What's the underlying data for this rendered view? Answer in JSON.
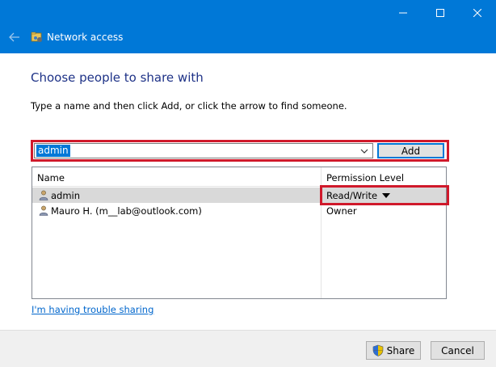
{
  "window": {
    "title": "Network access",
    "controls": [
      "minimize-icon",
      "maximize-icon",
      "close-icon"
    ]
  },
  "dialog": {
    "heading": "Choose people to share with",
    "instructions": "Type a name and then click Add, or click the arrow to find someone.",
    "name_input_value": "admin",
    "add_label": "Add",
    "trouble_link": "I'm having trouble sharing"
  },
  "table": {
    "columns": [
      "Name",
      "Permission Level"
    ],
    "rows": [
      {
        "name": "admin",
        "permission": "Read/Write",
        "selected": true,
        "has_dropdown": true
      },
      {
        "name": "Mauro H. (m__lab@outlook.com)",
        "permission": "Owner",
        "selected": false,
        "has_dropdown": false
      }
    ]
  },
  "footer": {
    "share_label": "Share",
    "cancel_label": "Cancel"
  },
  "colors": {
    "titlebar": "#0078d7",
    "heading": "#1e3287",
    "highlight": "#d0192b",
    "link": "#0066cc"
  }
}
